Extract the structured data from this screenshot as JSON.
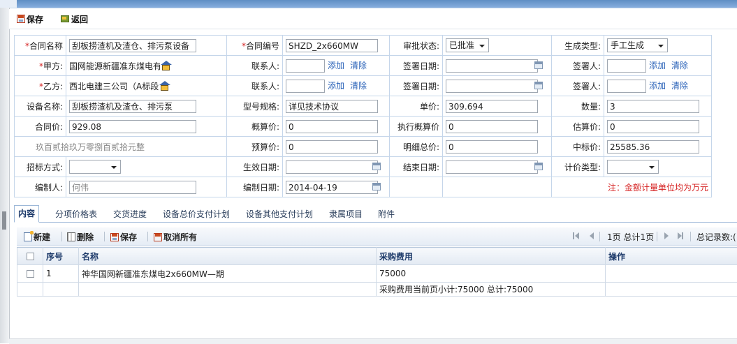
{
  "toolbar": {
    "save": "保存",
    "back": "返回"
  },
  "form": {
    "contract_name": {
      "label": "合同名称",
      "value": "刮板捞渣机及渣仓、排污泵设备"
    },
    "contract_no": {
      "label": "合同编号",
      "value": "SHZD_2x660MW"
    },
    "approval_status": {
      "label": "审批状态:",
      "value": "已批准"
    },
    "gen_type": {
      "label": "生成类型:",
      "value": "手工生成"
    },
    "party_a": {
      "label": "甲方:",
      "value": "国网能源新疆准东煤电有"
    },
    "party_b": {
      "label": "乙方:",
      "value": "西北电建三公司（A标段"
    },
    "contact": {
      "label": "联系人:"
    },
    "sign_date": {
      "label": "签署日期:"
    },
    "signer": {
      "label": "签署人:"
    },
    "add_link": "添加",
    "clear_link": "清除",
    "equip_name": {
      "label": "设备名称:",
      "value": "刮板捞渣机及渣仓、排污泵"
    },
    "model_spec": {
      "label": "型号规格:",
      "value": "详见技术协议"
    },
    "unit_price": {
      "label": "单价:",
      "value": "309.694"
    },
    "quantity": {
      "label": "数量:",
      "value": "3"
    },
    "contract_price": {
      "label": "合同价:",
      "value": "929.08"
    },
    "budget_est": {
      "label": "概算价:",
      "value": "0"
    },
    "exec_budget": {
      "label": "执行概算价",
      "value": "0"
    },
    "estimate": {
      "label": "估算价:",
      "value": "0"
    },
    "amount_cn": "玖百贰拾玖万零捌百贰拾元整",
    "forecast": {
      "label": "预算价:",
      "value": "0"
    },
    "detail_total": {
      "label": "明细总价:",
      "value": "0"
    },
    "bid_price": {
      "label": "中标价:",
      "value": "25585.36"
    },
    "bid_method": {
      "label": "招标方式:",
      "value": ""
    },
    "effective_date": {
      "label": "生效日期:"
    },
    "end_date": {
      "label": "结束日期:"
    },
    "pricing_type": {
      "label": "计价类型:",
      "value": ""
    },
    "editor": {
      "label": "编制人:",
      "value": "何伟"
    },
    "edit_date": {
      "label": "编制日期:",
      "value": "2014-04-19"
    },
    "note": "注：金额计量单位均为万元"
  },
  "tabs": [
    "内容",
    "分项价格表",
    "交货进度",
    "设备总价支付计划",
    "设备其他支付计划",
    "隶属项目",
    "附件"
  ],
  "grid_toolbar": {
    "new": "新建",
    "delete": "删除",
    "save": "保存",
    "cancel_all": "取消所有",
    "page_info": "1页 总计1页",
    "total_label": "总记录数:("
  },
  "grid": {
    "columns": [
      "序号",
      "名称",
      "采购费用",
      "操作"
    ],
    "rows": [
      {
        "no": "1",
        "name": "神华国网新疆准东煤电2x660MW—期",
        "cost": "75000",
        "op": ""
      }
    ],
    "summary": "采购费用当前页小计:75000 总计:75000"
  }
}
